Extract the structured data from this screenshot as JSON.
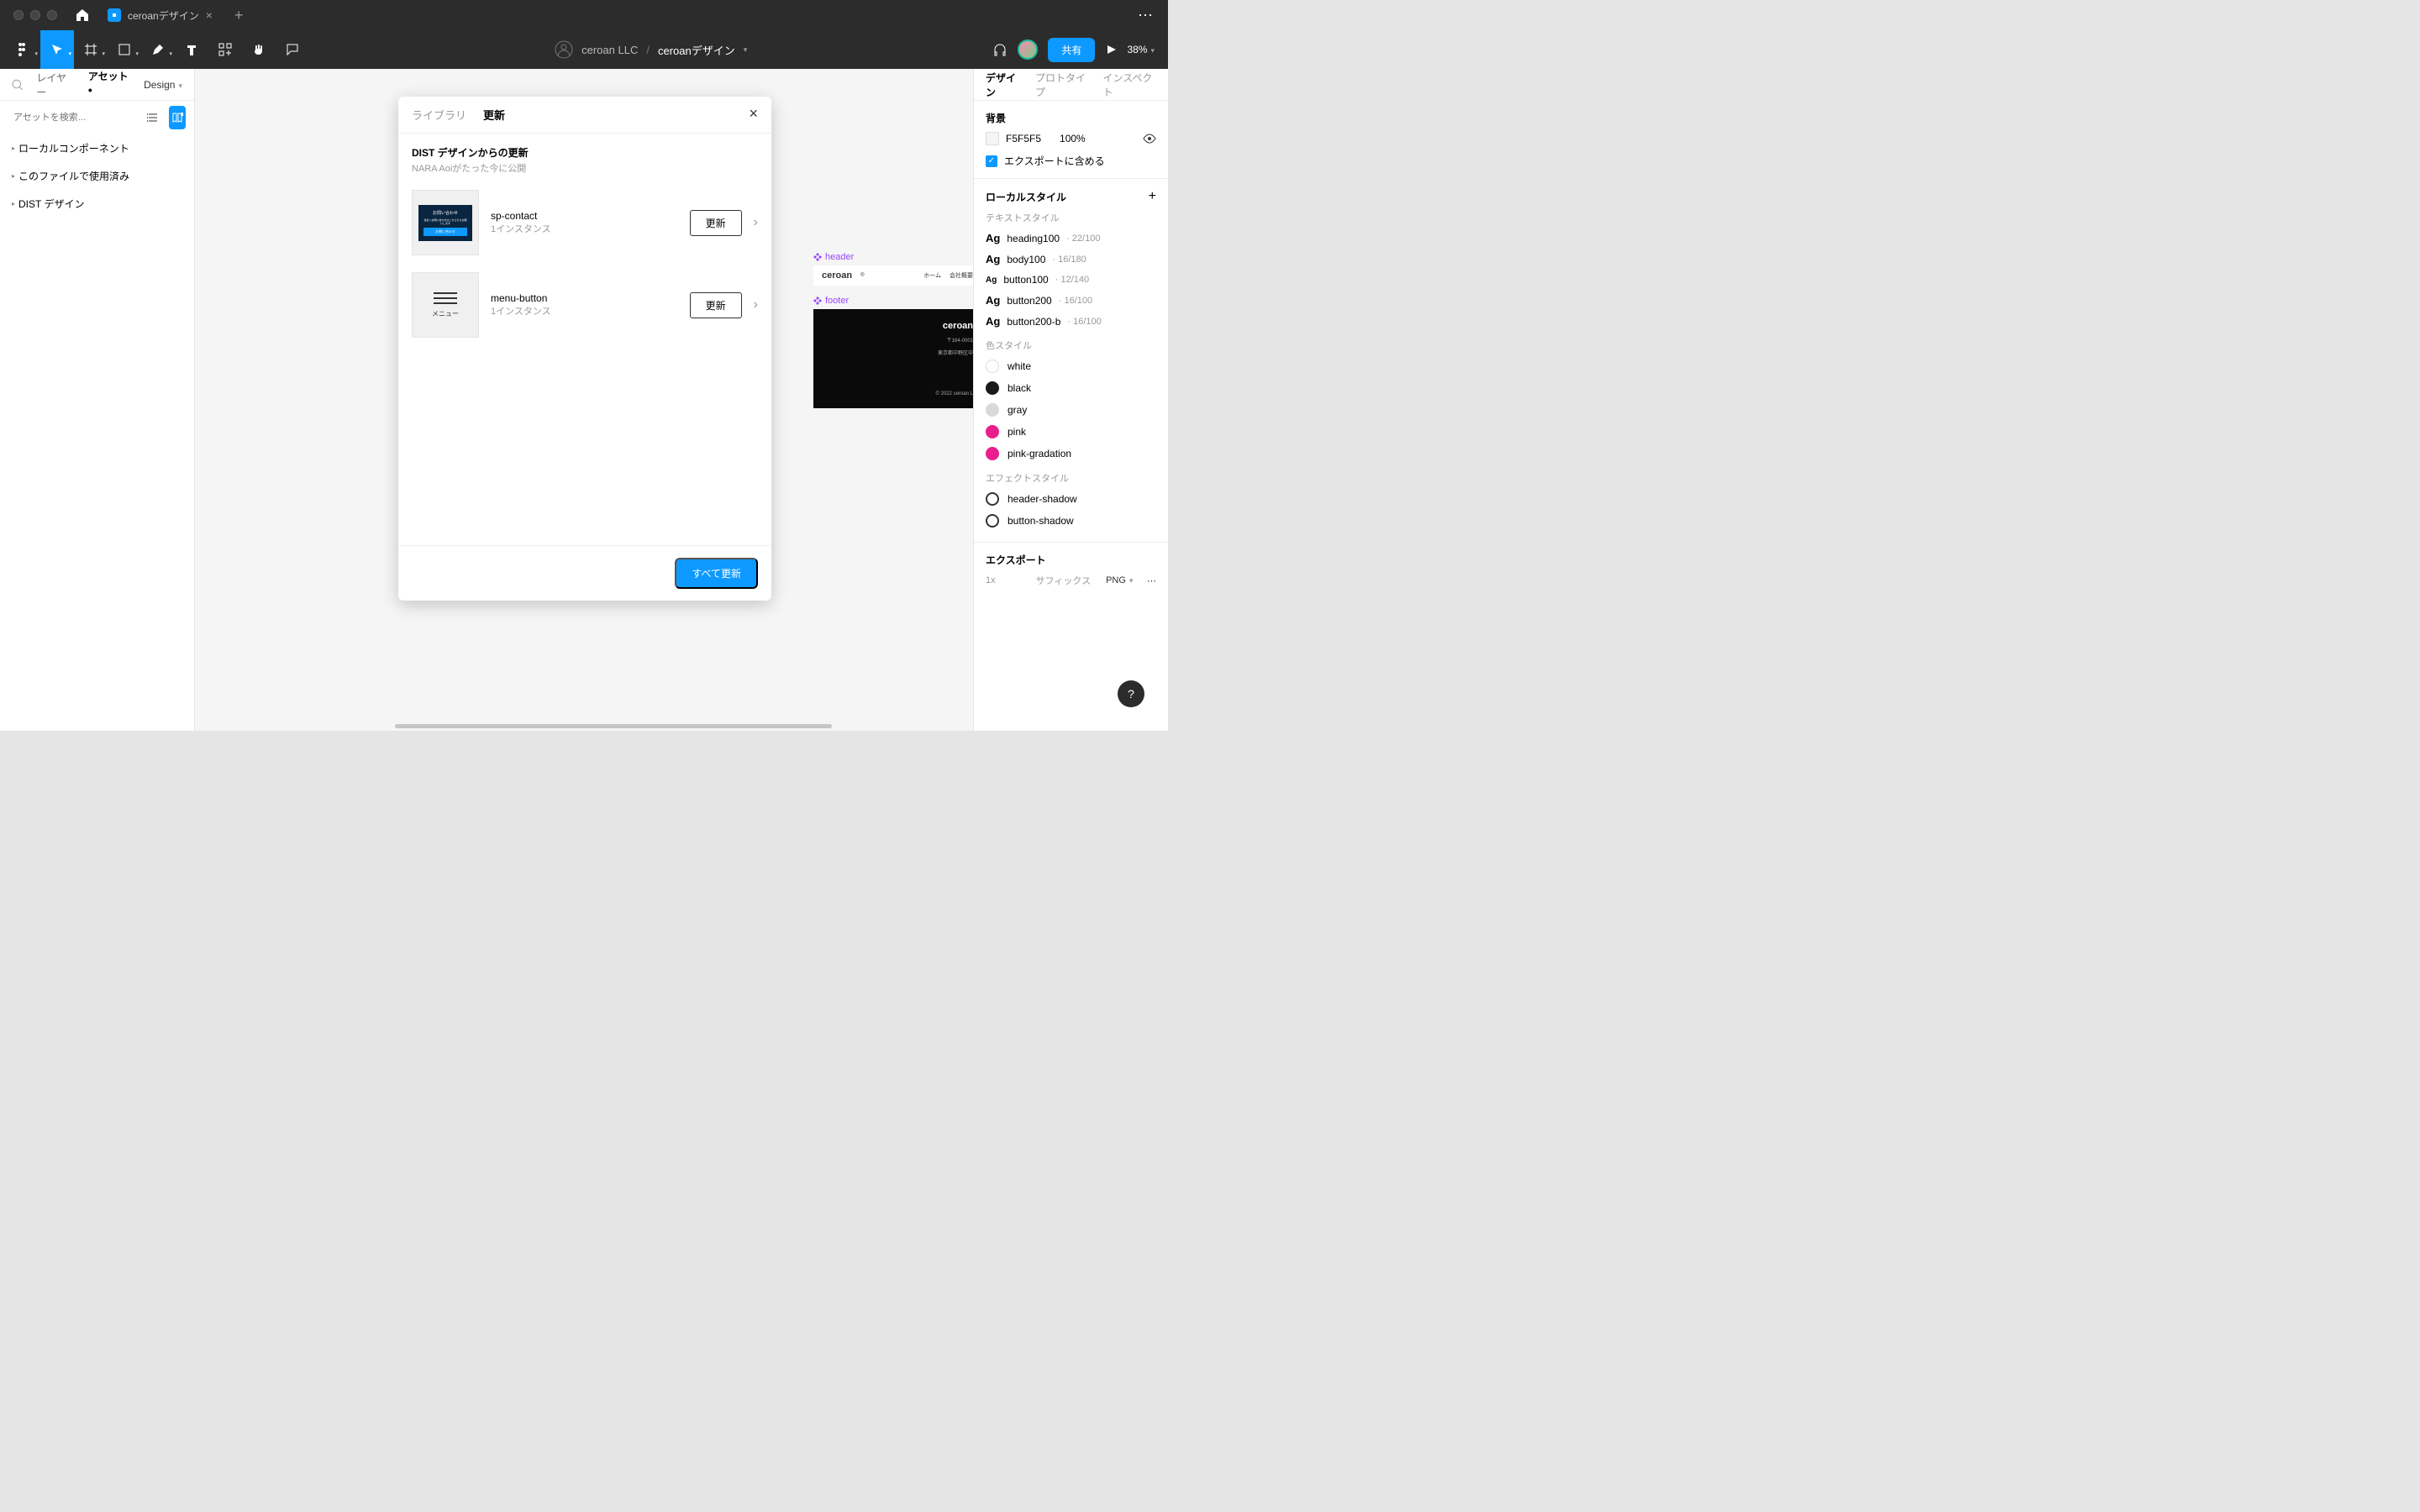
{
  "titlebar": {
    "tab_label": "ceroanデザイン"
  },
  "toolbar": {
    "team": "ceroan LLC",
    "file": "ceroanデザイン",
    "share": "共有",
    "zoom": "38%"
  },
  "left_panel": {
    "search_icon": "検索",
    "tabs": {
      "layers": "レイヤー",
      "assets": "アセット",
      "page": "Design"
    },
    "search_placeholder": "アセットを検索...",
    "items": [
      "ローカルコンポーネント",
      "このファイルで使用済み",
      "DIST デザイン"
    ]
  },
  "modal": {
    "tabs": {
      "library": "ライブラリ",
      "updates": "更新"
    },
    "source_title": "DIST デザインからの更新",
    "publisher": "NARA Aoiがたった今に公開",
    "rows": [
      {
        "name": "sp-contact",
        "sub": "1インスタンス",
        "btn": "更新",
        "thumb_lines": [
          "お問い合わせ",
          "当社へお問い合わせはこちらからお願いします",
          "お問い合わせ"
        ],
        "thumb_sub": ""
      },
      {
        "name": "menu-button",
        "sub": "1インスタンス",
        "btn": "更新",
        "thumb_sub": "メニュー"
      }
    ],
    "update_all": "すべて更新"
  },
  "canvas": {
    "header_label": "header",
    "footer_label": "footer",
    "brand": "ceroan",
    "nav1": "ホーム",
    "nav2": "会社概要",
    "footer_zip": "〒164-0001",
    "footer_addr": "東京都中野区中",
    "footer_copy": "© 2022 ceroan L"
  },
  "right_panel": {
    "tabs": {
      "design": "デザイン",
      "prototype": "プロトタイプ",
      "inspect": "インスペクト"
    },
    "bg_title": "背景",
    "bg_hex": "F5F5F5",
    "bg_opacity": "100%",
    "include_export": "エクスポートに含める",
    "local_styles": "ローカルスタイル",
    "text_styles_label": "テキストスタイル",
    "text_styles": [
      {
        "name": "heading100",
        "meta": "· 22/100",
        "size": "ag"
      },
      {
        "name": "body100",
        "meta": "· 16/180",
        "size": "ag"
      },
      {
        "name": "button100",
        "meta": "· 12/140",
        "size": "sm"
      },
      {
        "name": "button200",
        "meta": "· 16/100",
        "size": "ag"
      },
      {
        "name": "button200-b",
        "meta": "· 16/100",
        "size": "ag"
      }
    ],
    "color_styles_label": "色スタイル",
    "color_styles": [
      {
        "name": "white",
        "hex": "#ffffff"
      },
      {
        "name": "black",
        "hex": "#1a1a1a"
      },
      {
        "name": "gray",
        "hex": "#d9d9d9"
      },
      {
        "name": "pink",
        "hex": "#e91e8c"
      },
      {
        "name": "pink-gradation",
        "hex": "#e91e8c"
      }
    ],
    "effect_styles_label": "エフェクトスタイル",
    "effect_styles": [
      "header-shadow",
      "button-shadow"
    ],
    "export_title": "エクスポート",
    "export_scale": "1x",
    "export_suffix_label": "サフィックス",
    "export_format": "PNG"
  }
}
